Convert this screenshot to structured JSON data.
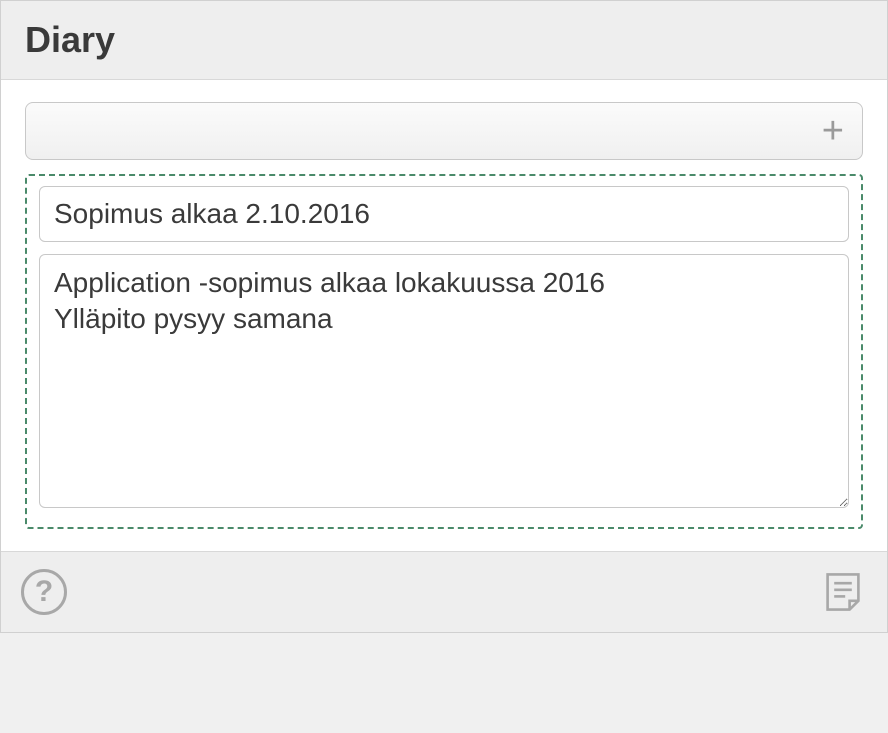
{
  "header": {
    "title": "Diary"
  },
  "addBar": {
    "plus_label": "+"
  },
  "entry": {
    "title": "Sopimus alkaa 2.10.2016",
    "body": "Application -sopimus alkaa lokakuussa 2016\nYlläpito pysyy samana"
  },
  "footer": {
    "help_label": "?"
  }
}
